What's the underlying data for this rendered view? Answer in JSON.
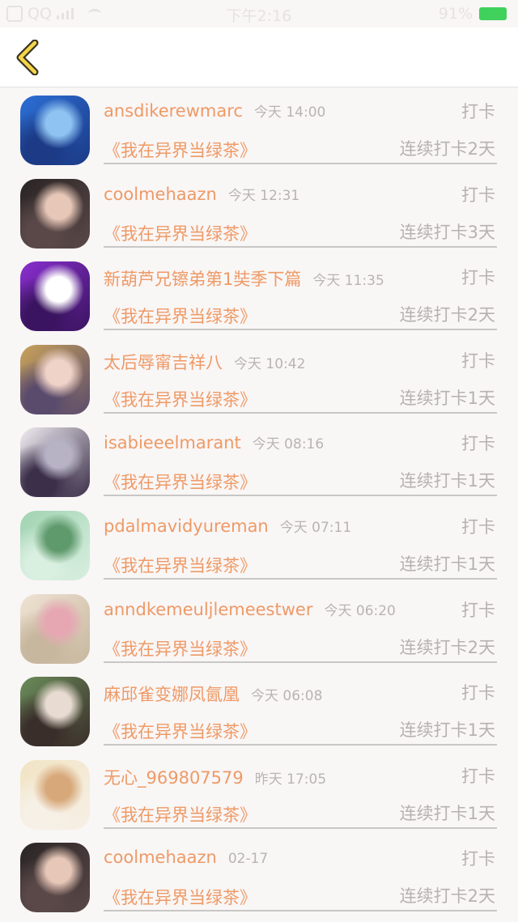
{
  "status": {
    "carrier": "QQ",
    "time": "下午2:16",
    "battery": "91%"
  },
  "nav": {
    "back_icon": "chevron-left-icon"
  },
  "items": [
    {
      "user": "ansdikerewmarc",
      "time": "今天 14:00",
      "tag": "打卡",
      "book": "《我在异界当绿茶》",
      "streak": "连续打卡2天",
      "avatar_colors": [
        "#2c6fd6",
        "#8fc3f2",
        "#1c3a86"
      ]
    },
    {
      "user": "coolmehaazn",
      "time": "今天 12:31",
      "tag": "打卡",
      "book": "《我在异界当绿茶》",
      "streak": "连续打卡3天",
      "avatar_colors": [
        "#2a2424",
        "#e7c7b7",
        "#5a4848"
      ]
    },
    {
      "user": "新葫芦兄镲弟第1奘季下篇",
      "time": "今天 11:35",
      "tag": "打卡",
      "book": "《我在异界当绿茶》",
      "streak": "连续打卡2天",
      "avatar_colors": [
        "#8a2fd0",
        "#ffffff",
        "#3a1460"
      ]
    },
    {
      "user": "太后辱甯吉祥八",
      "time": "今天 10:42",
      "tag": "打卡",
      "book": "《我在异界当绿茶》",
      "streak": "连续打卡1天",
      "avatar_colors": [
        "#c9a25a",
        "#efd2c8",
        "#5a4b6c"
      ]
    },
    {
      "user": "isabieeelmarant",
      "time": "今天 08:16",
      "tag": "打卡",
      "book": "《我在异界当绿茶》",
      "streak": "连续打卡1天",
      "avatar_colors": [
        "#f1eef2",
        "#b7b3c5",
        "#3c2f4a"
      ]
    },
    {
      "user": "pdalmavidyureman",
      "time": "今天 07:11",
      "tag": "打卡",
      "book": "《我在异界当绿茶》",
      "streak": "连续打卡1天",
      "avatar_colors": [
        "#9fd3b0",
        "#5f9a6d",
        "#d9efe0"
      ]
    },
    {
      "user": "anndkemeuljlemeestwer",
      "time": "今天 06:20",
      "tag": "打卡",
      "book": "《我在异界当绿茶》",
      "streak": "连续打卡2天",
      "avatar_colors": [
        "#efe3d4",
        "#e6a7b3",
        "#c7b79e"
      ]
    },
    {
      "user": "麻邱雀变娜凤氤凰",
      "time": "今天 06:08",
      "tag": "打卡",
      "book": "《我在异界当绿茶》",
      "streak": "连续打卡1天",
      "avatar_colors": [
        "#6b8d5a",
        "#e8dcd2",
        "#3a2e2a"
      ]
    },
    {
      "user": "无心_969807579",
      "time": "昨天 17:05",
      "tag": "打卡",
      "book": "《我在异界当绿茶》",
      "streak": "连续打卡1天",
      "avatar_colors": [
        "#f1e3c2",
        "#d7a87a",
        "#f6f0e6"
      ]
    },
    {
      "user": "coolmehaazn",
      "time": "02-17",
      "tag": "打卡",
      "book": "《我在异界当绿茶》",
      "streak": "连续打卡2天",
      "avatar_colors": [
        "#2a2424",
        "#e7c7b7",
        "#5a4848"
      ]
    }
  ]
}
